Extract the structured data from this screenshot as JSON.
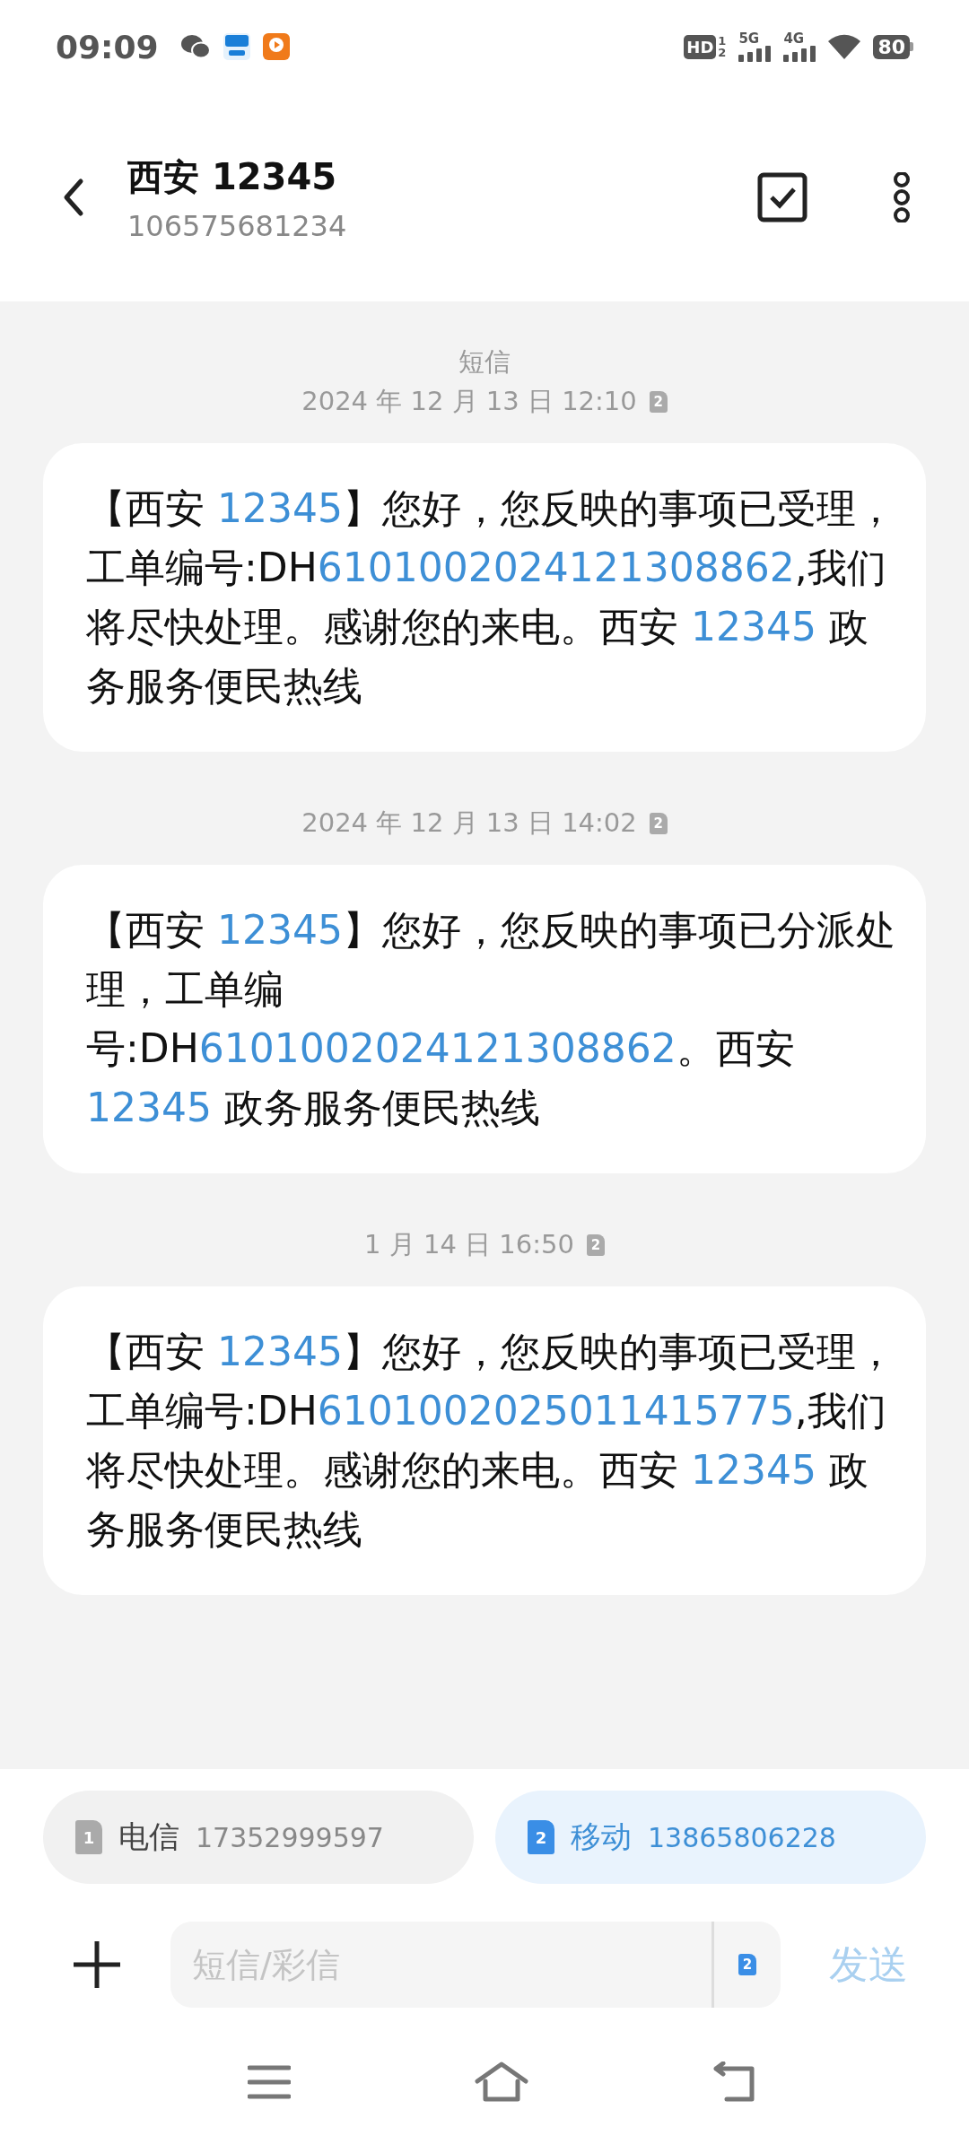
{
  "status_bar": {
    "time": "09:09",
    "hd_label": "HD",
    "hd_sub": [
      "1",
      "2"
    ],
    "networks": [
      "5G",
      "4G"
    ],
    "battery": "80"
  },
  "header": {
    "title": "西安 12345",
    "subtitle": "106575681234"
  },
  "thread": {
    "channel_label": "短信",
    "messages": [
      {
        "timestamp": "2024 年 12 月 13 日 12:10",
        "sim": "2",
        "parts": [
          {
            "text": "【西安 ",
            "kind": "text"
          },
          {
            "text": "12345",
            "kind": "link"
          },
          {
            "text": "】您好，您反映的事项已受理，工单编号:DH",
            "kind": "text"
          },
          {
            "text": "6101002024121308862",
            "kind": "link"
          },
          {
            "text": ",我们将尽快处理。感谢您的来电。西安 ",
            "kind": "text"
          },
          {
            "text": "12345",
            "kind": "link"
          },
          {
            "text": " 政务服务便民热线",
            "kind": "text"
          }
        ]
      },
      {
        "timestamp": "2024 年 12 月 13 日 14:02",
        "sim": "2",
        "parts": [
          {
            "text": "【西安 ",
            "kind": "text"
          },
          {
            "text": "12345",
            "kind": "link"
          },
          {
            "text": "】您好，您反映的事项已分派处理，工单编号:DH",
            "kind": "text"
          },
          {
            "text": "6101002024121308862",
            "kind": "link"
          },
          {
            "text": "。西安 ",
            "kind": "text"
          },
          {
            "text": "12345",
            "kind": "link"
          },
          {
            "text": " 政务服务便民热线",
            "kind": "text"
          }
        ]
      },
      {
        "timestamp": "1 月 14 日 16:50",
        "sim": "2",
        "parts": [
          {
            "text": "【西安 ",
            "kind": "text"
          },
          {
            "text": "12345",
            "kind": "link"
          },
          {
            "text": "】您好，您反映的事项已受理，工单编号:DH",
            "kind": "text"
          },
          {
            "text": "6101002025011415775",
            "kind": "link"
          },
          {
            "text": ",我们将尽快处理。感谢您的来电。西安 ",
            "kind": "text"
          },
          {
            "text": "12345",
            "kind": "link"
          },
          {
            "text": " 政务服务便民热线",
            "kind": "text"
          }
        ]
      }
    ]
  },
  "sim_cards": [
    {
      "slot": "1",
      "carrier": "电信",
      "number": "17352999597",
      "selected": false
    },
    {
      "slot": "2",
      "carrier": "移动",
      "number": "13865806228",
      "selected": true
    }
  ],
  "composer": {
    "placeholder": "短信/彩信",
    "sim": "2",
    "send_label": "发送",
    "send_disabled": true
  }
}
